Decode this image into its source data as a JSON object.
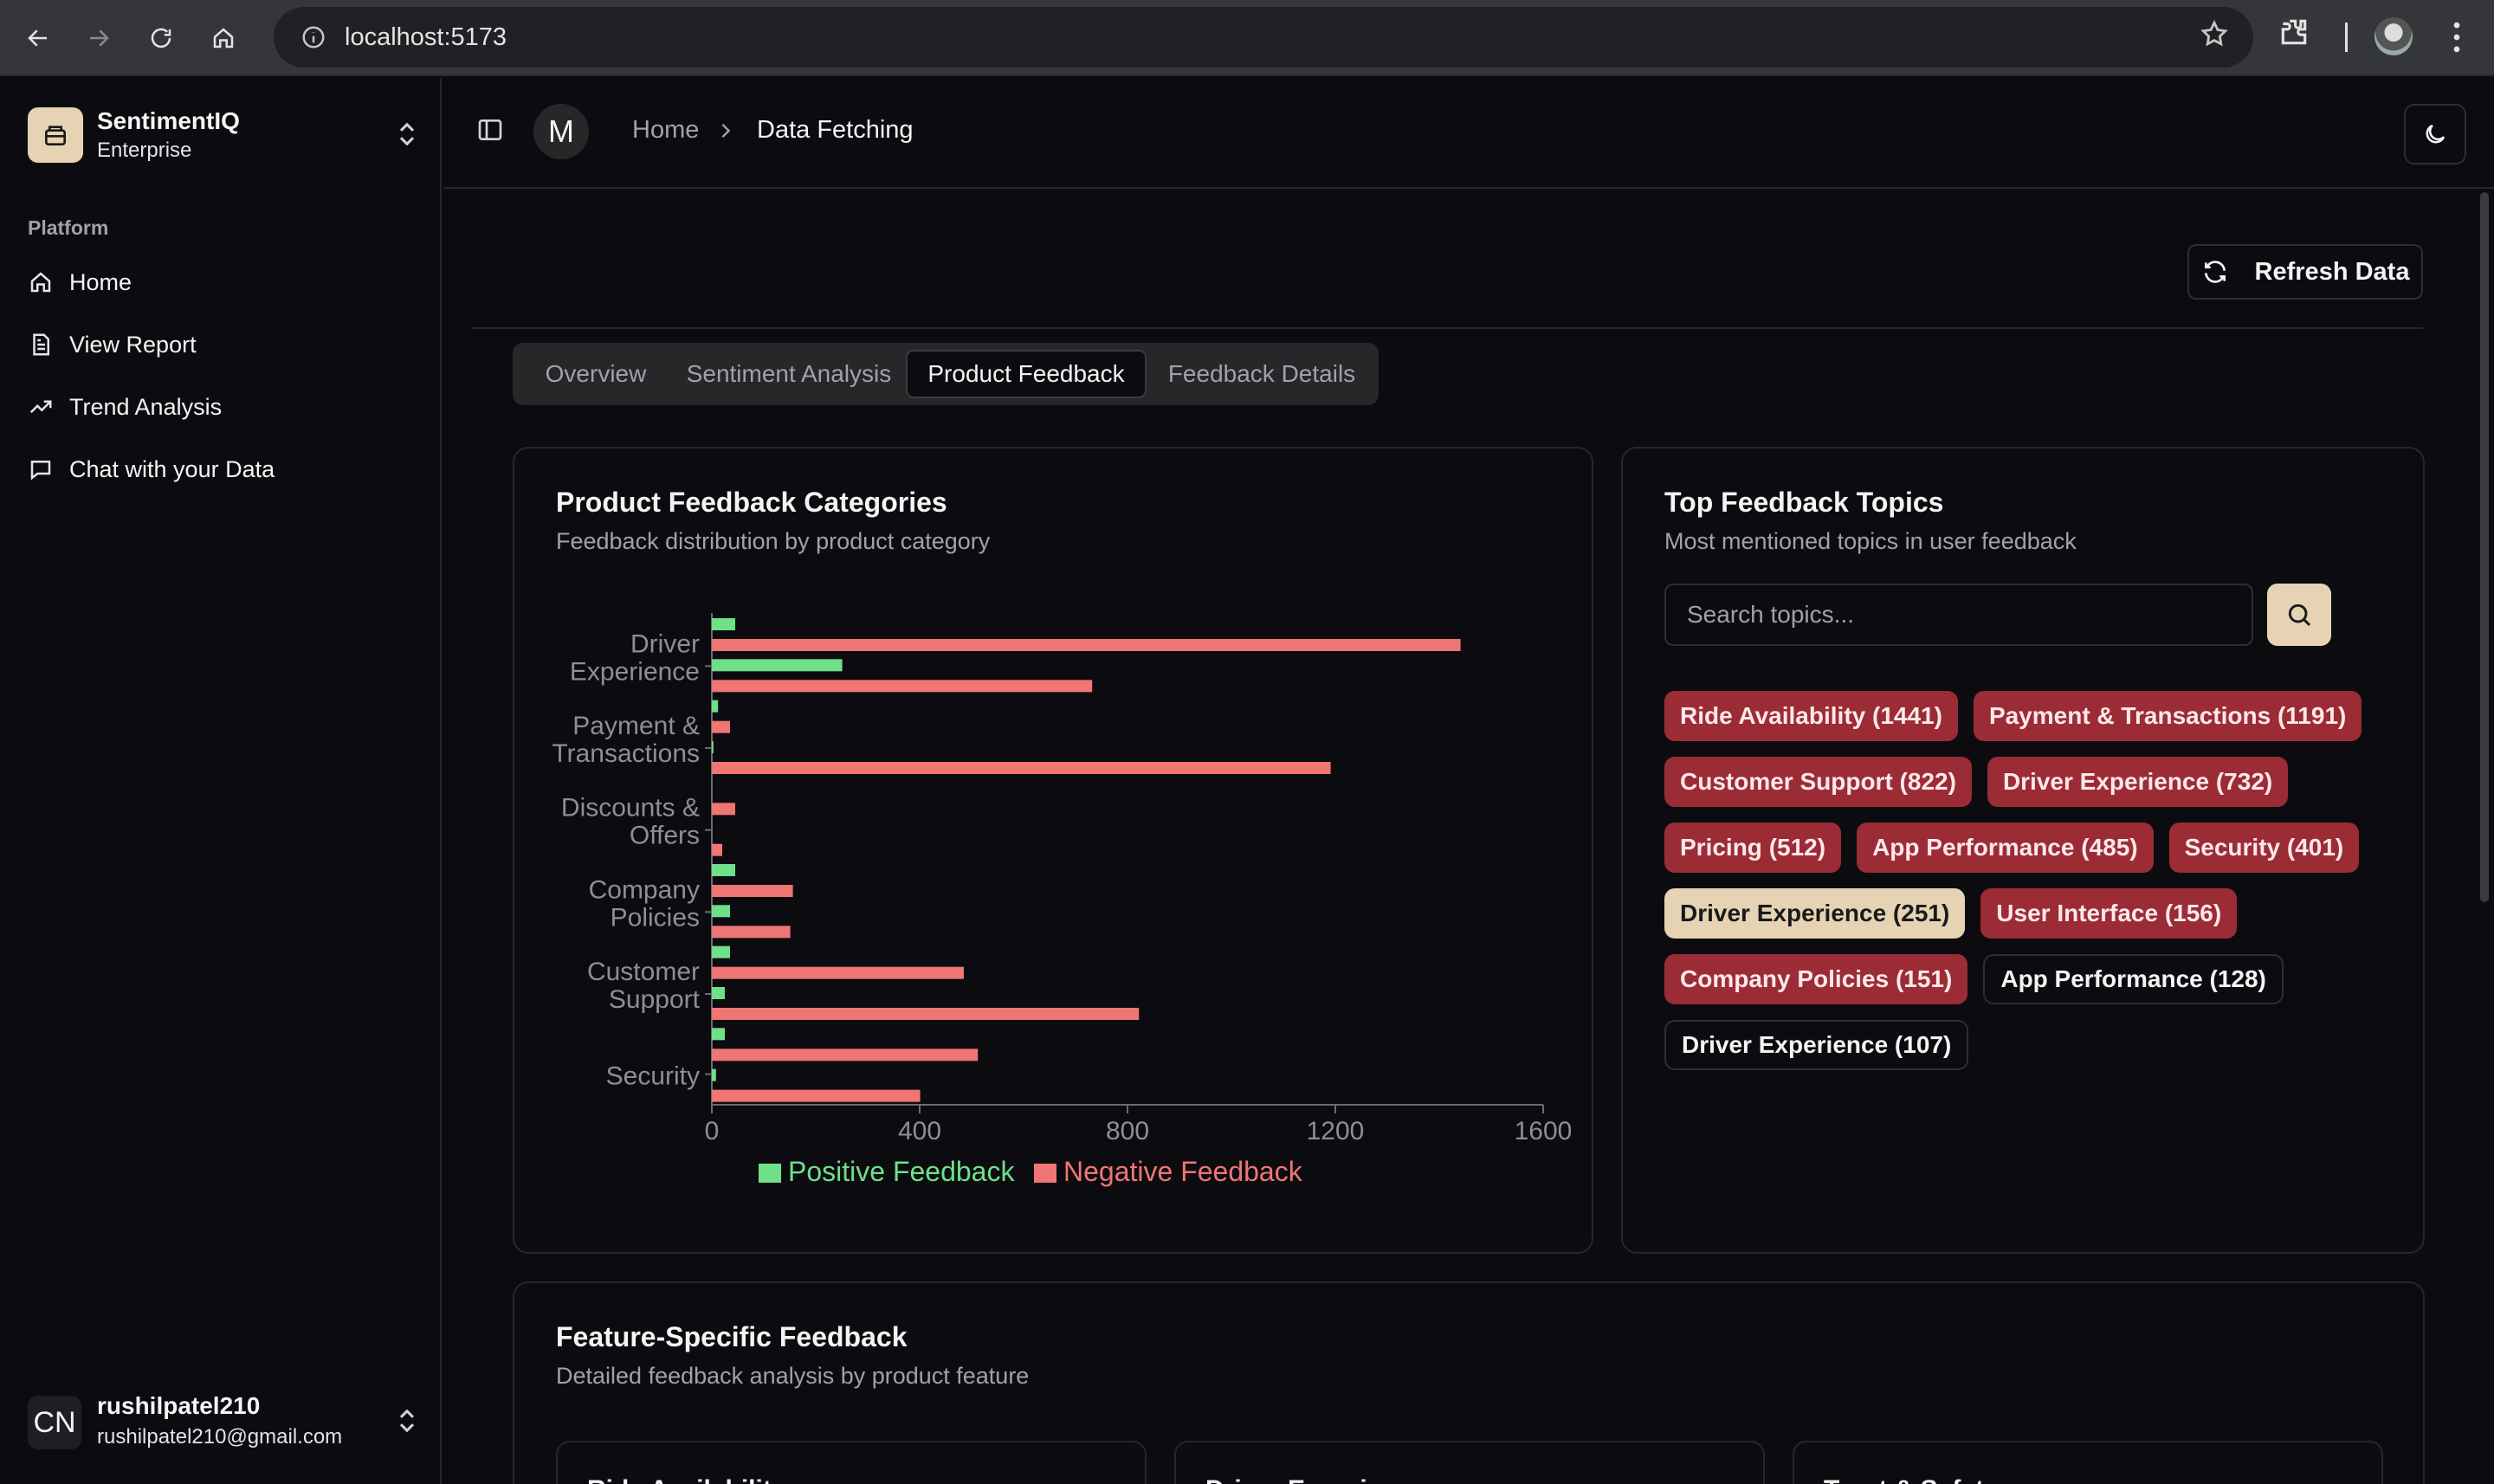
{
  "browser": {
    "url": "localhost:5173"
  },
  "sidebar": {
    "brand_name": "SentimentIQ",
    "brand_plan": "Enterprise",
    "section_label": "Platform",
    "items": [
      {
        "label": "Home",
        "icon": "home-icon"
      },
      {
        "label": "View Report",
        "icon": "file-icon"
      },
      {
        "label": "Trend Analysis",
        "icon": "trend-icon"
      },
      {
        "label": "Chat with your Data",
        "icon": "chat-icon"
      }
    ],
    "user": {
      "initials": "CN",
      "name": "rushilpatel210",
      "email": "rushilpatel210@gmail.com"
    }
  },
  "header": {
    "avatar_letter": "M",
    "breadcrumb_home": "Home",
    "breadcrumb_current": "Data Fetching"
  },
  "toolbar": {
    "refresh_label": "Refresh Data"
  },
  "tabs": [
    {
      "label": "Overview",
      "active": false
    },
    {
      "label": "Sentiment Analysis",
      "active": false
    },
    {
      "label": "Product Feedback",
      "active": true
    },
    {
      "label": "Feedback Details",
      "active": false
    }
  ],
  "categories_card": {
    "title": "Product Feedback Categories",
    "subtitle": "Feedback distribution by product category"
  },
  "chart_data": {
    "type": "bar",
    "orientation": "horizontal",
    "category_labels": [
      [
        "Driver",
        "Experience"
      ],
      [
        "Payment &",
        "Transactions"
      ],
      [
        "Discounts &",
        "Offers"
      ],
      [
        "Company",
        "Policies"
      ],
      [
        "Customer",
        "Support"
      ],
      [
        "Security"
      ]
    ],
    "rows": 12,
    "series": [
      {
        "name": "Positive Feedback",
        "color": "#6ee089",
        "values": [
          45,
          251,
          12,
          3,
          0,
          0,
          45,
          35,
          35,
          25,
          25,
          8
        ]
      },
      {
        "name": "Negative Feedback",
        "color": "#f07575",
        "values": [
          1441,
          732,
          35,
          1191,
          45,
          20,
          156,
          151,
          485,
          822,
          512,
          401
        ]
      }
    ],
    "xlim": [
      0,
      1600
    ],
    "xticks": [
      "0",
      "400",
      "800",
      "1200",
      "1600"
    ],
    "legend_position": "bottom"
  },
  "topics_card": {
    "title": "Top Feedback Topics",
    "subtitle": "Most mentioned topics in user feedback",
    "search_placeholder": "Search topics...",
    "topics": [
      {
        "label": "Ride Availability (1441)",
        "tone": "neg"
      },
      {
        "label": "Payment & Transactions (1191)",
        "tone": "neg"
      },
      {
        "label": "Customer Support (822)",
        "tone": "neg"
      },
      {
        "label": "Driver Experience (732)",
        "tone": "neg"
      },
      {
        "label": "Pricing (512)",
        "tone": "neg"
      },
      {
        "label": "App Performance (485)",
        "tone": "neg"
      },
      {
        "label": "Security (401)",
        "tone": "neg"
      },
      {
        "label": "Driver Experience (251)",
        "tone": "pos"
      },
      {
        "label": "User Interface (156)",
        "tone": "neg"
      },
      {
        "label": "Company Policies (151)",
        "tone": "neg"
      },
      {
        "label": "App Performance (128)",
        "tone": "neutral"
      },
      {
        "label": "Driver Experience (107)",
        "tone": "neutral"
      }
    ]
  },
  "feature_card": {
    "title": "Feature-Specific Feedback",
    "subtitle": "Detailed feedback analysis by product feature",
    "sub_cards": [
      "Ride Availability",
      "Driver Experience",
      "Trust & Safety"
    ]
  }
}
